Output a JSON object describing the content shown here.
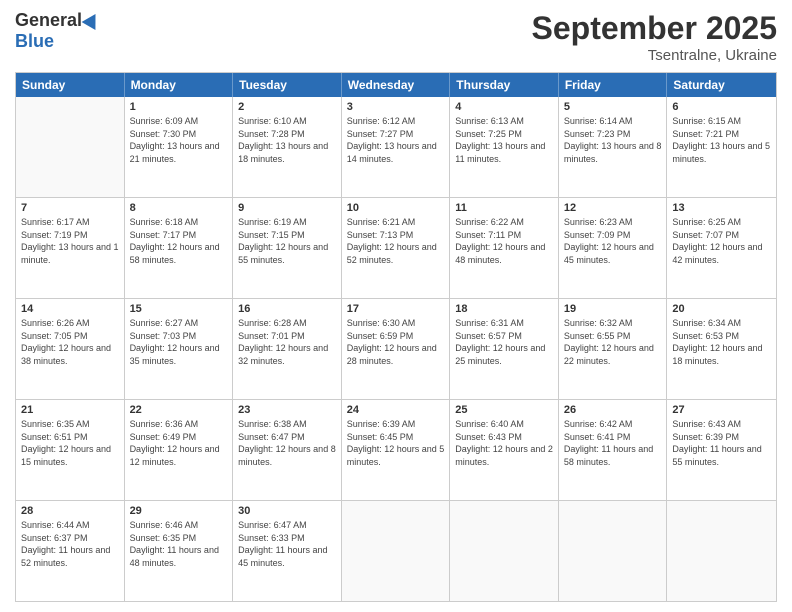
{
  "logo": {
    "general": "General",
    "blue": "Blue"
  },
  "title": "September 2025",
  "subtitle": "Tsentralne, Ukraine",
  "header_days": [
    "Sunday",
    "Monday",
    "Tuesday",
    "Wednesday",
    "Thursday",
    "Friday",
    "Saturday"
  ],
  "rows": [
    [
      {
        "day": "",
        "empty": true
      },
      {
        "day": "1",
        "sunrise": "Sunrise: 6:09 AM",
        "sunset": "Sunset: 7:30 PM",
        "daylight": "Daylight: 13 hours and 21 minutes."
      },
      {
        "day": "2",
        "sunrise": "Sunrise: 6:10 AM",
        "sunset": "Sunset: 7:28 PM",
        "daylight": "Daylight: 13 hours and 18 minutes."
      },
      {
        "day": "3",
        "sunrise": "Sunrise: 6:12 AM",
        "sunset": "Sunset: 7:27 PM",
        "daylight": "Daylight: 13 hours and 14 minutes."
      },
      {
        "day": "4",
        "sunrise": "Sunrise: 6:13 AM",
        "sunset": "Sunset: 7:25 PM",
        "daylight": "Daylight: 13 hours and 11 minutes."
      },
      {
        "day": "5",
        "sunrise": "Sunrise: 6:14 AM",
        "sunset": "Sunset: 7:23 PM",
        "daylight": "Daylight: 13 hours and 8 minutes."
      },
      {
        "day": "6",
        "sunrise": "Sunrise: 6:15 AM",
        "sunset": "Sunset: 7:21 PM",
        "daylight": "Daylight: 13 hours and 5 minutes."
      }
    ],
    [
      {
        "day": "7",
        "sunrise": "Sunrise: 6:17 AM",
        "sunset": "Sunset: 7:19 PM",
        "daylight": "Daylight: 13 hours and 1 minute."
      },
      {
        "day": "8",
        "sunrise": "Sunrise: 6:18 AM",
        "sunset": "Sunset: 7:17 PM",
        "daylight": "Daylight: 12 hours and 58 minutes."
      },
      {
        "day": "9",
        "sunrise": "Sunrise: 6:19 AM",
        "sunset": "Sunset: 7:15 PM",
        "daylight": "Daylight: 12 hours and 55 minutes."
      },
      {
        "day": "10",
        "sunrise": "Sunrise: 6:21 AM",
        "sunset": "Sunset: 7:13 PM",
        "daylight": "Daylight: 12 hours and 52 minutes."
      },
      {
        "day": "11",
        "sunrise": "Sunrise: 6:22 AM",
        "sunset": "Sunset: 7:11 PM",
        "daylight": "Daylight: 12 hours and 48 minutes."
      },
      {
        "day": "12",
        "sunrise": "Sunrise: 6:23 AM",
        "sunset": "Sunset: 7:09 PM",
        "daylight": "Daylight: 12 hours and 45 minutes."
      },
      {
        "day": "13",
        "sunrise": "Sunrise: 6:25 AM",
        "sunset": "Sunset: 7:07 PM",
        "daylight": "Daylight: 12 hours and 42 minutes."
      }
    ],
    [
      {
        "day": "14",
        "sunrise": "Sunrise: 6:26 AM",
        "sunset": "Sunset: 7:05 PM",
        "daylight": "Daylight: 12 hours and 38 minutes."
      },
      {
        "day": "15",
        "sunrise": "Sunrise: 6:27 AM",
        "sunset": "Sunset: 7:03 PM",
        "daylight": "Daylight: 12 hours and 35 minutes."
      },
      {
        "day": "16",
        "sunrise": "Sunrise: 6:28 AM",
        "sunset": "Sunset: 7:01 PM",
        "daylight": "Daylight: 12 hours and 32 minutes."
      },
      {
        "day": "17",
        "sunrise": "Sunrise: 6:30 AM",
        "sunset": "Sunset: 6:59 PM",
        "daylight": "Daylight: 12 hours and 28 minutes."
      },
      {
        "day": "18",
        "sunrise": "Sunrise: 6:31 AM",
        "sunset": "Sunset: 6:57 PM",
        "daylight": "Daylight: 12 hours and 25 minutes."
      },
      {
        "day": "19",
        "sunrise": "Sunrise: 6:32 AM",
        "sunset": "Sunset: 6:55 PM",
        "daylight": "Daylight: 12 hours and 22 minutes."
      },
      {
        "day": "20",
        "sunrise": "Sunrise: 6:34 AM",
        "sunset": "Sunset: 6:53 PM",
        "daylight": "Daylight: 12 hours and 18 minutes."
      }
    ],
    [
      {
        "day": "21",
        "sunrise": "Sunrise: 6:35 AM",
        "sunset": "Sunset: 6:51 PM",
        "daylight": "Daylight: 12 hours and 15 minutes."
      },
      {
        "day": "22",
        "sunrise": "Sunrise: 6:36 AM",
        "sunset": "Sunset: 6:49 PM",
        "daylight": "Daylight: 12 hours and 12 minutes."
      },
      {
        "day": "23",
        "sunrise": "Sunrise: 6:38 AM",
        "sunset": "Sunset: 6:47 PM",
        "daylight": "Daylight: 12 hours and 8 minutes."
      },
      {
        "day": "24",
        "sunrise": "Sunrise: 6:39 AM",
        "sunset": "Sunset: 6:45 PM",
        "daylight": "Daylight: 12 hours and 5 minutes."
      },
      {
        "day": "25",
        "sunrise": "Sunrise: 6:40 AM",
        "sunset": "Sunset: 6:43 PM",
        "daylight": "Daylight: 12 hours and 2 minutes."
      },
      {
        "day": "26",
        "sunrise": "Sunrise: 6:42 AM",
        "sunset": "Sunset: 6:41 PM",
        "daylight": "Daylight: 11 hours and 58 minutes."
      },
      {
        "day": "27",
        "sunrise": "Sunrise: 6:43 AM",
        "sunset": "Sunset: 6:39 PM",
        "daylight": "Daylight: 11 hours and 55 minutes."
      }
    ],
    [
      {
        "day": "28",
        "sunrise": "Sunrise: 6:44 AM",
        "sunset": "Sunset: 6:37 PM",
        "daylight": "Daylight: 11 hours and 52 minutes."
      },
      {
        "day": "29",
        "sunrise": "Sunrise: 6:46 AM",
        "sunset": "Sunset: 6:35 PM",
        "daylight": "Daylight: 11 hours and 48 minutes."
      },
      {
        "day": "30",
        "sunrise": "Sunrise: 6:47 AM",
        "sunset": "Sunset: 6:33 PM",
        "daylight": "Daylight: 11 hours and 45 minutes."
      },
      {
        "day": "",
        "empty": true
      },
      {
        "day": "",
        "empty": true
      },
      {
        "day": "",
        "empty": true
      },
      {
        "day": "",
        "empty": true
      }
    ]
  ]
}
